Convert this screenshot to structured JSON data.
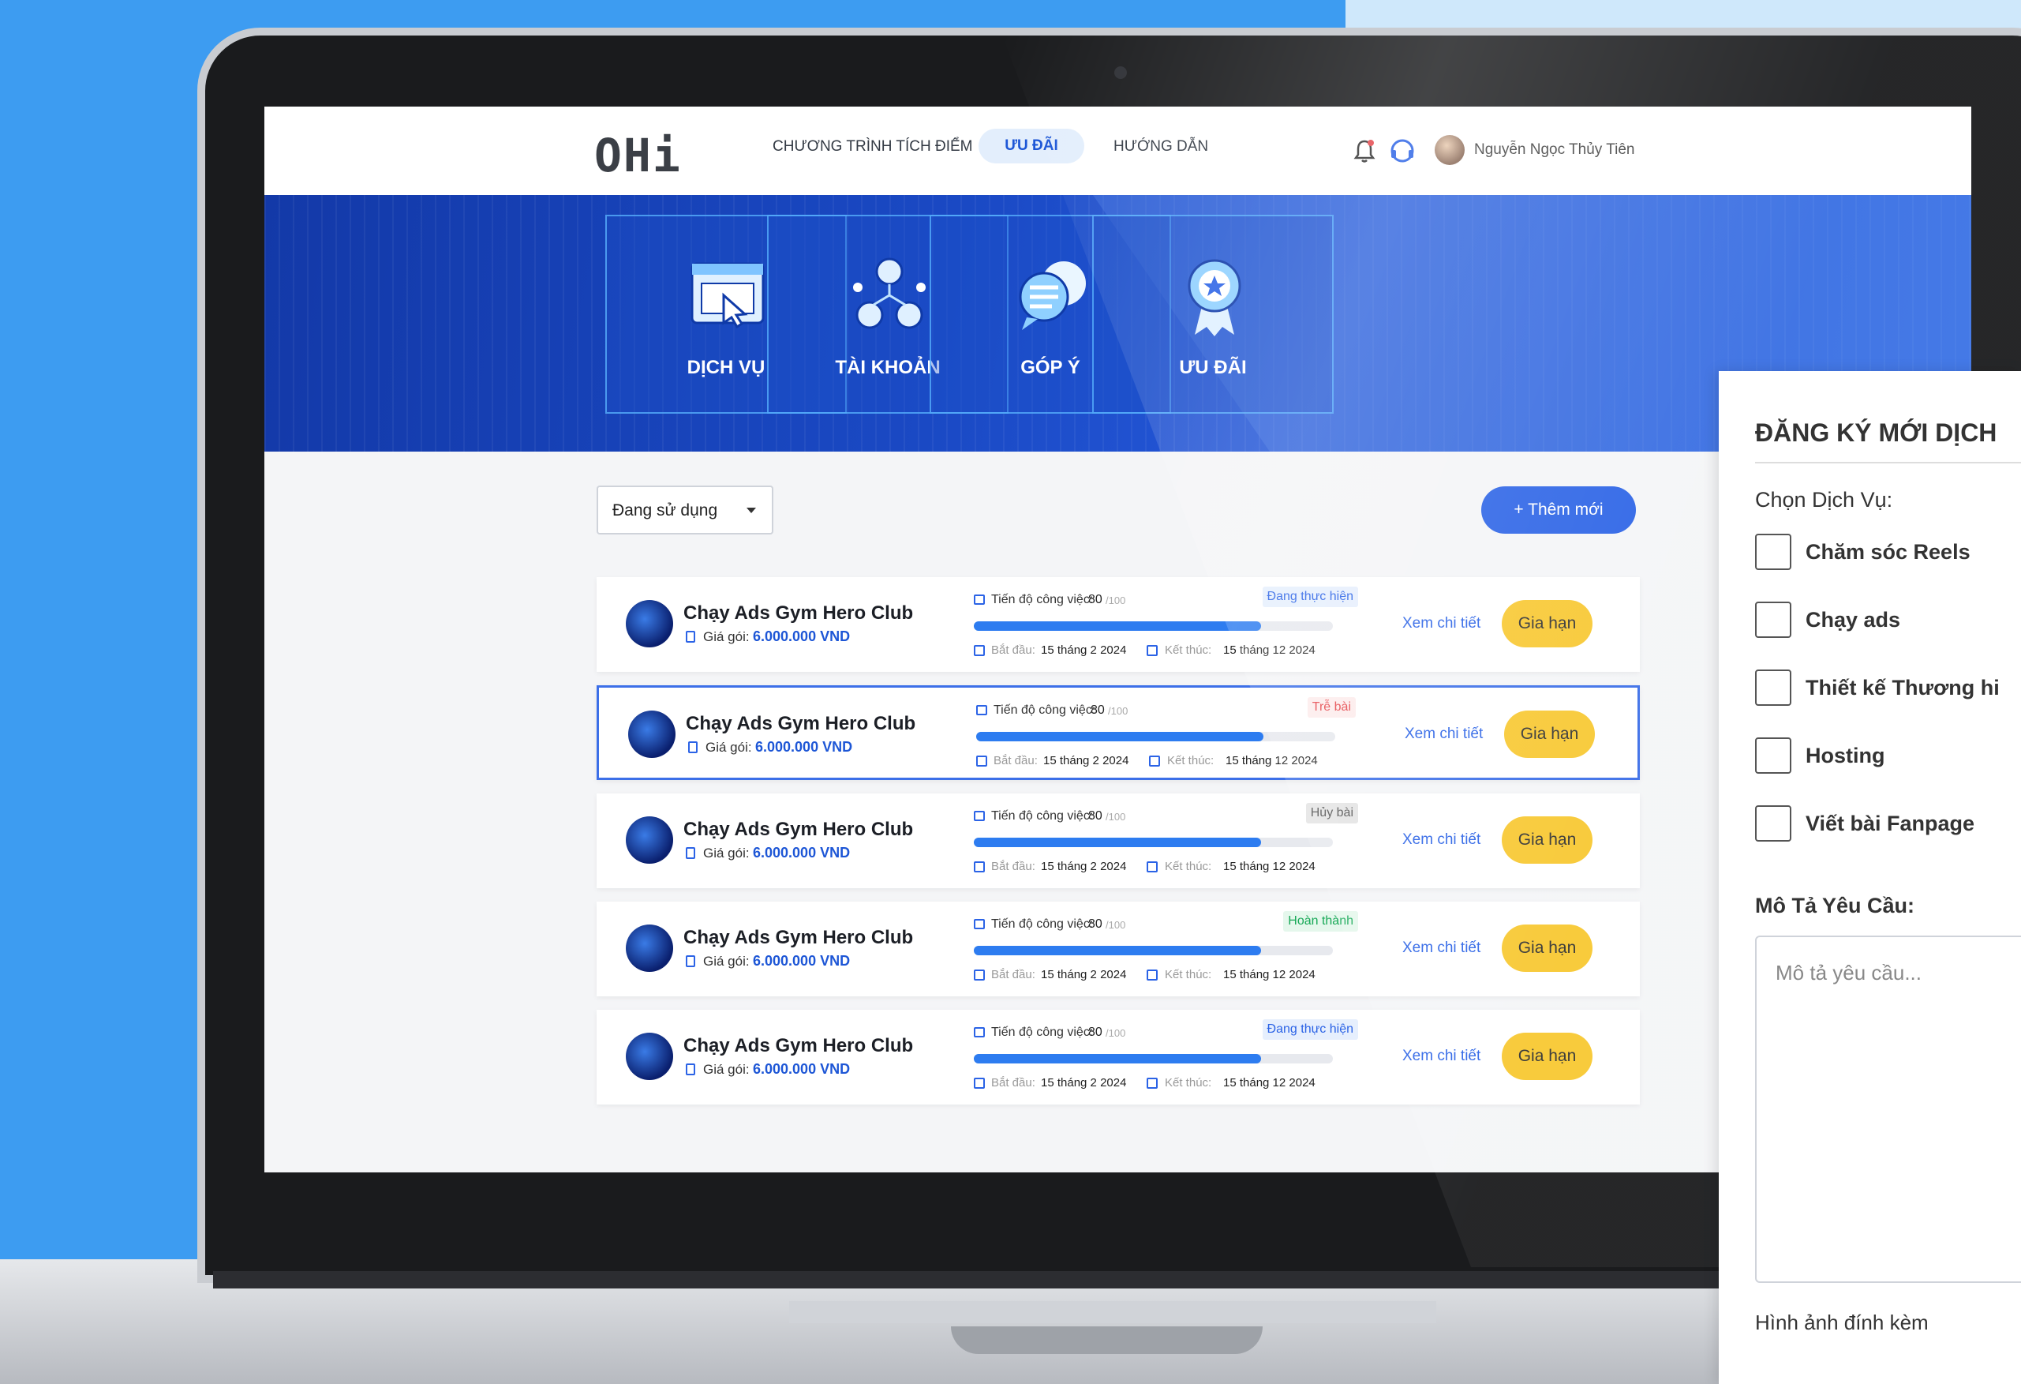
{
  "topbar": {
    "logo": "OHi",
    "nav": [
      "CHƯƠNG TRÌNH TÍCH ĐIỂM",
      "ƯU ĐÃI",
      "HƯỚNG DẪN"
    ],
    "active_nav": "ƯU ĐÃI",
    "user_name": "Nguyễn Ngọc Thủy Tiên"
  },
  "tiles": [
    "DỊCH VỤ",
    "TÀI KHOẢN",
    "GÓP Ý",
    "ƯU ĐÃI"
  ],
  "filter": {
    "selected": "Đang sử dụng"
  },
  "add_button": "+ Thêm mới",
  "cards": [
    {
      "title": "Chạy Ads Gym Hero Club",
      "price_label": "Giá gói:",
      "price": "6.000.000 VND",
      "progress_label": "Tiến độ công việc:",
      "progress": "80",
      "progress_total": "/100",
      "progress_fraction": 0.8,
      "status": "Đang thực hiện",
      "start_label": "Bắt đầu:",
      "start": "15 tháng 2 2024",
      "end_label": "Kết thúc:",
      "end": "15 tháng 12 2024",
      "detail": "Xem chi tiết",
      "renew": "Gia hạn"
    },
    {
      "title": "Chạy Ads Gym Hero Club",
      "price_label": "Giá gói:",
      "price": "6.000.000 VND",
      "progress_label": "Tiến độ công việc:",
      "progress": "80",
      "progress_total": "/100",
      "progress_fraction": 0.8,
      "status": "Trễ bài",
      "start_label": "Bắt đầu:",
      "start": "15 tháng 2 2024",
      "end_label": "Kết thúc:",
      "end": "15 tháng 12 2024",
      "detail": "Xem chi tiết",
      "renew": "Gia hạn"
    },
    {
      "title": "Chạy Ads Gym Hero Club",
      "price_label": "Giá gói:",
      "price": "6.000.000 VND",
      "progress_label": "Tiến độ công việc:",
      "progress": "80",
      "progress_total": "/100",
      "progress_fraction": 0.8,
      "status": "Hủy bài",
      "start_label": "Bắt đầu:",
      "start": "15 tháng 2 2024",
      "end_label": "Kết thúc:",
      "end": "15 tháng 12 2024",
      "detail": "Xem chi tiết",
      "renew": "Gia hạn"
    },
    {
      "title": "Chạy Ads Gym Hero Club",
      "price_label": "Giá gói:",
      "price": "6.000.000 VND",
      "progress_label": "Tiến độ công việc:",
      "progress": "80",
      "progress_total": "/100",
      "progress_fraction": 0.8,
      "status": "Hoàn thành",
      "start_label": "Bắt đầu:",
      "start": "15 tháng 2 2024",
      "end_label": "Kết thúc:",
      "end": "15 tháng 12 2024",
      "detail": "Xem chi tiết",
      "renew": "Gia hạn"
    },
    {
      "title": "Chạy Ads Gym Hero Club",
      "price_label": "Giá gói:",
      "price": "6.000.000 VND",
      "progress_label": "Tiến độ công việc:",
      "progress": "80",
      "progress_total": "/100",
      "progress_fraction": 0.8,
      "status": "Đang thực hiện",
      "start_label": "Bắt đầu:",
      "start": "15 tháng 2 2024",
      "end_label": "Kết thúc:",
      "end": "15 tháng 12 2024",
      "detail": "Xem chi tiết",
      "renew": "Gia hạn"
    }
  ],
  "status_colors": {
    "Đang thực hiện": {
      "fg": "#2b63e6",
      "bg": "#e6effd"
    },
    "Trễ bài": {
      "fg": "#e5484d",
      "bg": "#fdecec"
    },
    "Hủy bài": {
      "fg": "#555555",
      "bg": "#e4e4e4"
    },
    "Hoàn thành": {
      "fg": "#18a957",
      "bg": "#e5f7ec"
    }
  },
  "panel": {
    "title": "ĐĂNG KÝ MỚI DỊCH",
    "choose_label": "Chọn Dịch Vụ:",
    "options": [
      "Chăm sóc Reels",
      "Chạy ads",
      "Thiết kế Thương hi",
      "Hosting",
      "Viết bài Fanpage"
    ],
    "desc_label": "Mô Tả Yêu Cầu:",
    "desc_placeholder": "Mô tả yêu cầu...",
    "attach_label": "Hình ảnh đính kèm"
  },
  "colors": {
    "accent": "#2b63e6",
    "renew": "#f8c832",
    "background": "#3b9bf0"
  }
}
